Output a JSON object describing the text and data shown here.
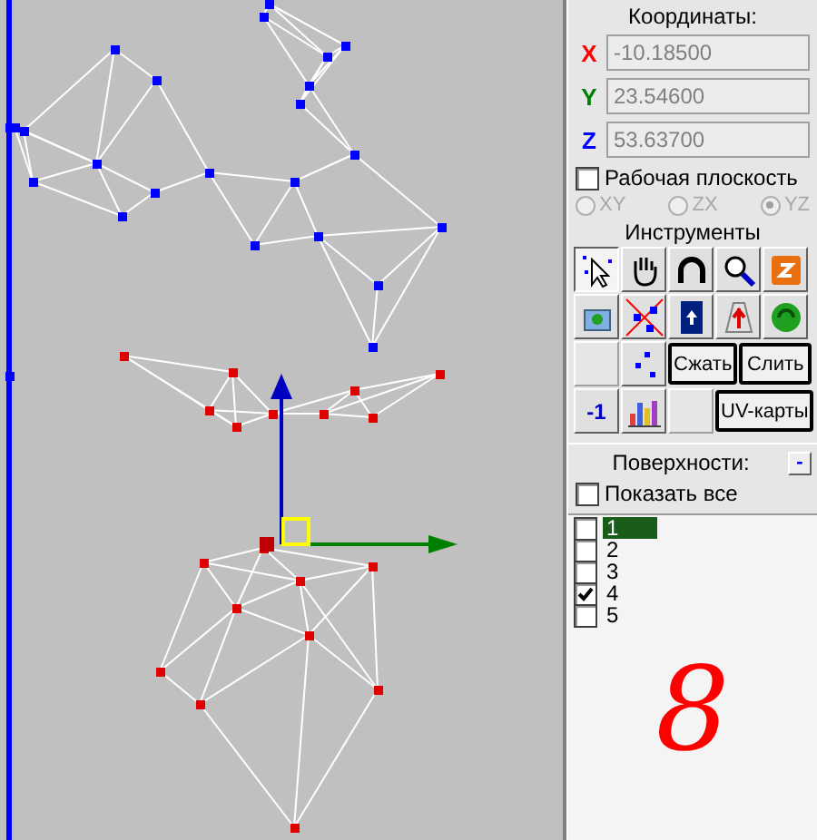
{
  "coordinates": {
    "title": "Координаты:",
    "fields": [
      {
        "axis": "X",
        "color": "#ff0000",
        "value": "-10.18500"
      },
      {
        "axis": "Y",
        "color": "#008000",
        "value": "23.54600"
      },
      {
        "axis": "Z",
        "color": "#0000ff",
        "value": "53.63700"
      }
    ]
  },
  "work_plane": {
    "label": "Рабочая плоскость",
    "checked": false,
    "disabled_options": true,
    "options": [
      {
        "label": "XY",
        "selected": false
      },
      {
        "label": "ZX",
        "selected": false
      },
      {
        "label": "YZ",
        "selected": true
      }
    ]
  },
  "tools": {
    "title": "Инструменты",
    "icon_tools": [
      {
        "selected": true
      },
      {
        "selected": false
      },
      {
        "selected": false
      },
      {
        "selected": false
      },
      {
        "selected": false
      },
      {
        "selected": false
      },
      {
        "selected": false
      },
      {
        "selected": false
      },
      {
        "selected": false
      },
      {
        "selected": false
      },
      {
        "selected": false
      },
      {
        "selected": false
      }
    ],
    "buttons": [
      {
        "label": "Сжать"
      },
      {
        "label": "Слить"
      },
      {
        "label": "-1"
      },
      {
        "label": "UV-карты"
      }
    ]
  },
  "surfaces": {
    "title": "Поверхности:",
    "collapse": "-",
    "show_all": {
      "label": "Показать все",
      "checked": false
    },
    "items": [
      {
        "label": "1",
        "checked": false,
        "selected": true
      },
      {
        "label": "2",
        "checked": false,
        "selected": false
      },
      {
        "label": "3",
        "checked": false,
        "selected": false
      },
      {
        "label": "4",
        "checked": true,
        "selected": false
      },
      {
        "label": "5",
        "checked": false,
        "selected": false
      }
    ],
    "annotation": "8"
  }
}
